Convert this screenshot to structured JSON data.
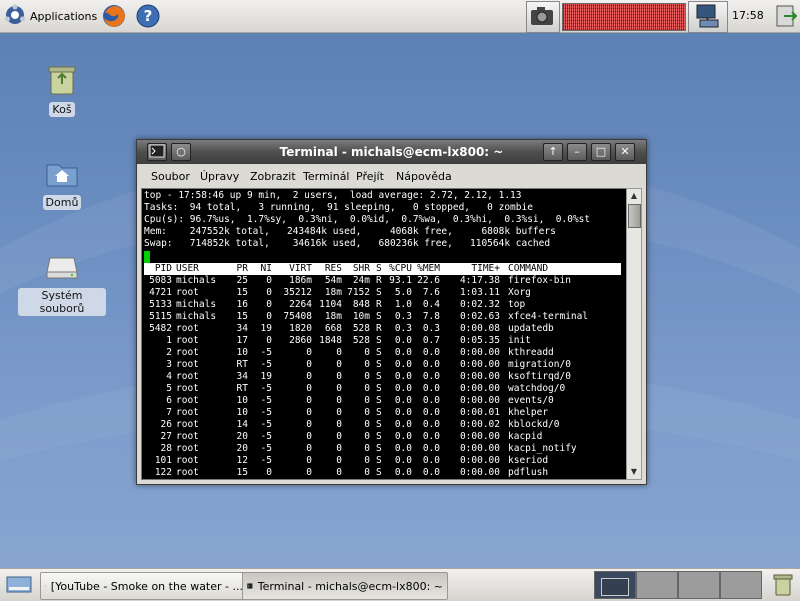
{
  "colors": {
    "terminal_bg": "#000000",
    "terminal_fg": "#ffffff",
    "cursor": "#00d000",
    "titlebar": "#4f4f4f"
  },
  "top_panel": {
    "apps_label": "Applications",
    "clock": "17:58",
    "icons": [
      "applications-icon",
      "firefox-icon",
      "help-icon",
      "screenshot-camera-icon",
      "cpu-graph",
      "network-icon",
      "logout-icon"
    ]
  },
  "desktop": {
    "icons": [
      {
        "label": "Koš",
        "icon": "trash-icon"
      },
      {
        "label": "Domů",
        "icon": "home-folder-icon"
      },
      {
        "label": "Systém souborů",
        "icon": "filesystem-drive-icon"
      }
    ]
  },
  "window": {
    "title": "Terminal - michals@ecm-lx800: ~",
    "menu": [
      "Soubor",
      "Úpravy",
      "Zobrazit",
      "Terminál",
      "Přejít",
      "Nápověda"
    ],
    "summary": [
      "top - 17:58:46 up 9 min,  2 users,  load average: 2.72, 2.12, 1.13",
      "Tasks:  94 total,   3 running,  91 sleeping,   0 stopped,   0 zombie",
      "Cpu(s): 96.7%us,  1.7%sy,  0.3%ni,  0.0%id,  0.7%wa,  0.3%hi,  0.3%si,  0.0%st",
      "Mem:    247552k total,   243484k used,     4068k free,     6808k buffers",
      "Swap:   714852k total,    34616k used,   680236k free,   110564k cached"
    ],
    "columns": [
      "PID",
      "USER",
      "PR",
      "NI",
      "VIRT",
      "RES",
      "SHR",
      "S",
      "%CPU",
      "%MEM",
      "TIME+",
      "COMMAND"
    ],
    "processes": [
      [
        "5083",
        "michals",
        "25",
        "0",
        "186m",
        "54m",
        "24m",
        "R",
        "93.1",
        "22.6",
        "4:17.38",
        "firefox-bin"
      ],
      [
        "4721",
        "root",
        "15",
        "0",
        "35212",
        "18m",
        "7152",
        "S",
        "5.0",
        "7.6",
        "1:03.11",
        "Xorg"
      ],
      [
        "5133",
        "michals",
        "16",
        "0",
        "2264",
        "1104",
        "848",
        "R",
        "1.0",
        "0.4",
        "0:02.32",
        "top"
      ],
      [
        "5115",
        "michals",
        "15",
        "0",
        "75408",
        "18m",
        "10m",
        "S",
        "0.3",
        "7.8",
        "0:02.63",
        "xfce4-terminal"
      ],
      [
        "5482",
        "root",
        "34",
        "19",
        "1820",
        "668",
        "528",
        "R",
        "0.3",
        "0.3",
        "0:00.08",
        "updatedb"
      ],
      [
        "1",
        "root",
        "17",
        "0",
        "2860",
        "1848",
        "528",
        "S",
        "0.0",
        "0.7",
        "0:05.35",
        "init"
      ],
      [
        "2",
        "root",
        "10",
        "-5",
        "0",
        "0",
        "0",
        "S",
        "0.0",
        "0.0",
        "0:00.00",
        "kthreadd"
      ],
      [
        "3",
        "root",
        "RT",
        "-5",
        "0",
        "0",
        "0",
        "S",
        "0.0",
        "0.0",
        "0:00.00",
        "migration/0"
      ],
      [
        "4",
        "root",
        "34",
        "19",
        "0",
        "0",
        "0",
        "S",
        "0.0",
        "0.0",
        "0:00.00",
        "ksoftirqd/0"
      ],
      [
        "5",
        "root",
        "RT",
        "-5",
        "0",
        "0",
        "0",
        "S",
        "0.0",
        "0.0",
        "0:00.00",
        "watchdog/0"
      ],
      [
        "6",
        "root",
        "10",
        "-5",
        "0",
        "0",
        "0",
        "S",
        "0.0",
        "0.0",
        "0:00.00",
        "events/0"
      ],
      [
        "7",
        "root",
        "10",
        "-5",
        "0",
        "0",
        "0",
        "S",
        "0.0",
        "0.0",
        "0:00.01",
        "khelper"
      ],
      [
        "26",
        "root",
        "14",
        "-5",
        "0",
        "0",
        "0",
        "S",
        "0.0",
        "0.0",
        "0:00.02",
        "kblockd/0"
      ],
      [
        "27",
        "root",
        "20",
        "-5",
        "0",
        "0",
        "0",
        "S",
        "0.0",
        "0.0",
        "0:00.00",
        "kacpid"
      ],
      [
        "28",
        "root",
        "20",
        "-5",
        "0",
        "0",
        "0",
        "S",
        "0.0",
        "0.0",
        "0:00.00",
        "kacpi_notify"
      ],
      [
        "101",
        "root",
        "12",
        "-5",
        "0",
        "0",
        "0",
        "S",
        "0.0",
        "0.0",
        "0:00.00",
        "kseriod"
      ],
      [
        "122",
        "root",
        "15",
        "0",
        "0",
        "0",
        "0",
        "S",
        "0.0",
        "0.0",
        "0:00.00",
        "pdflush"
      ]
    ]
  },
  "taskbar": {
    "tasks": [
      {
        "label": "[YouTube - Smoke on the water - ...",
        "icon": "firefox-icon"
      },
      {
        "label": "Terminal - michals@ecm-lx800: ~",
        "icon": "terminal-icon"
      }
    ],
    "workspaces": 4
  }
}
